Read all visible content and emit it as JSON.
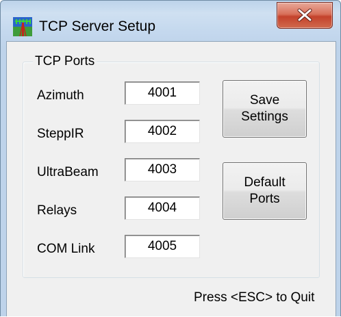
{
  "window": {
    "title": "TCP Server Setup",
    "close_glyph": "x",
    "icon": "antenna-tower-icon"
  },
  "group": {
    "label": "TCP Ports"
  },
  "ports": [
    {
      "label": "Azimuth",
      "value": "4001"
    },
    {
      "label": "SteppIR",
      "value": "4002"
    },
    {
      "label": "UltraBeam",
      "value": "4003"
    },
    {
      "label": "Relays",
      "value": "4004"
    },
    {
      "label": "COM Link",
      "value": "4005"
    }
  ],
  "buttons": {
    "save_line1": "Save",
    "save_line2": "Settings",
    "default_line1": "Default",
    "default_line2": "Ports"
  },
  "status": {
    "text": "Press <ESC> to Quit"
  },
  "colors": {
    "frame": "#bed3ea",
    "client": "#f0f0f0",
    "close_button": "#c4422b"
  }
}
